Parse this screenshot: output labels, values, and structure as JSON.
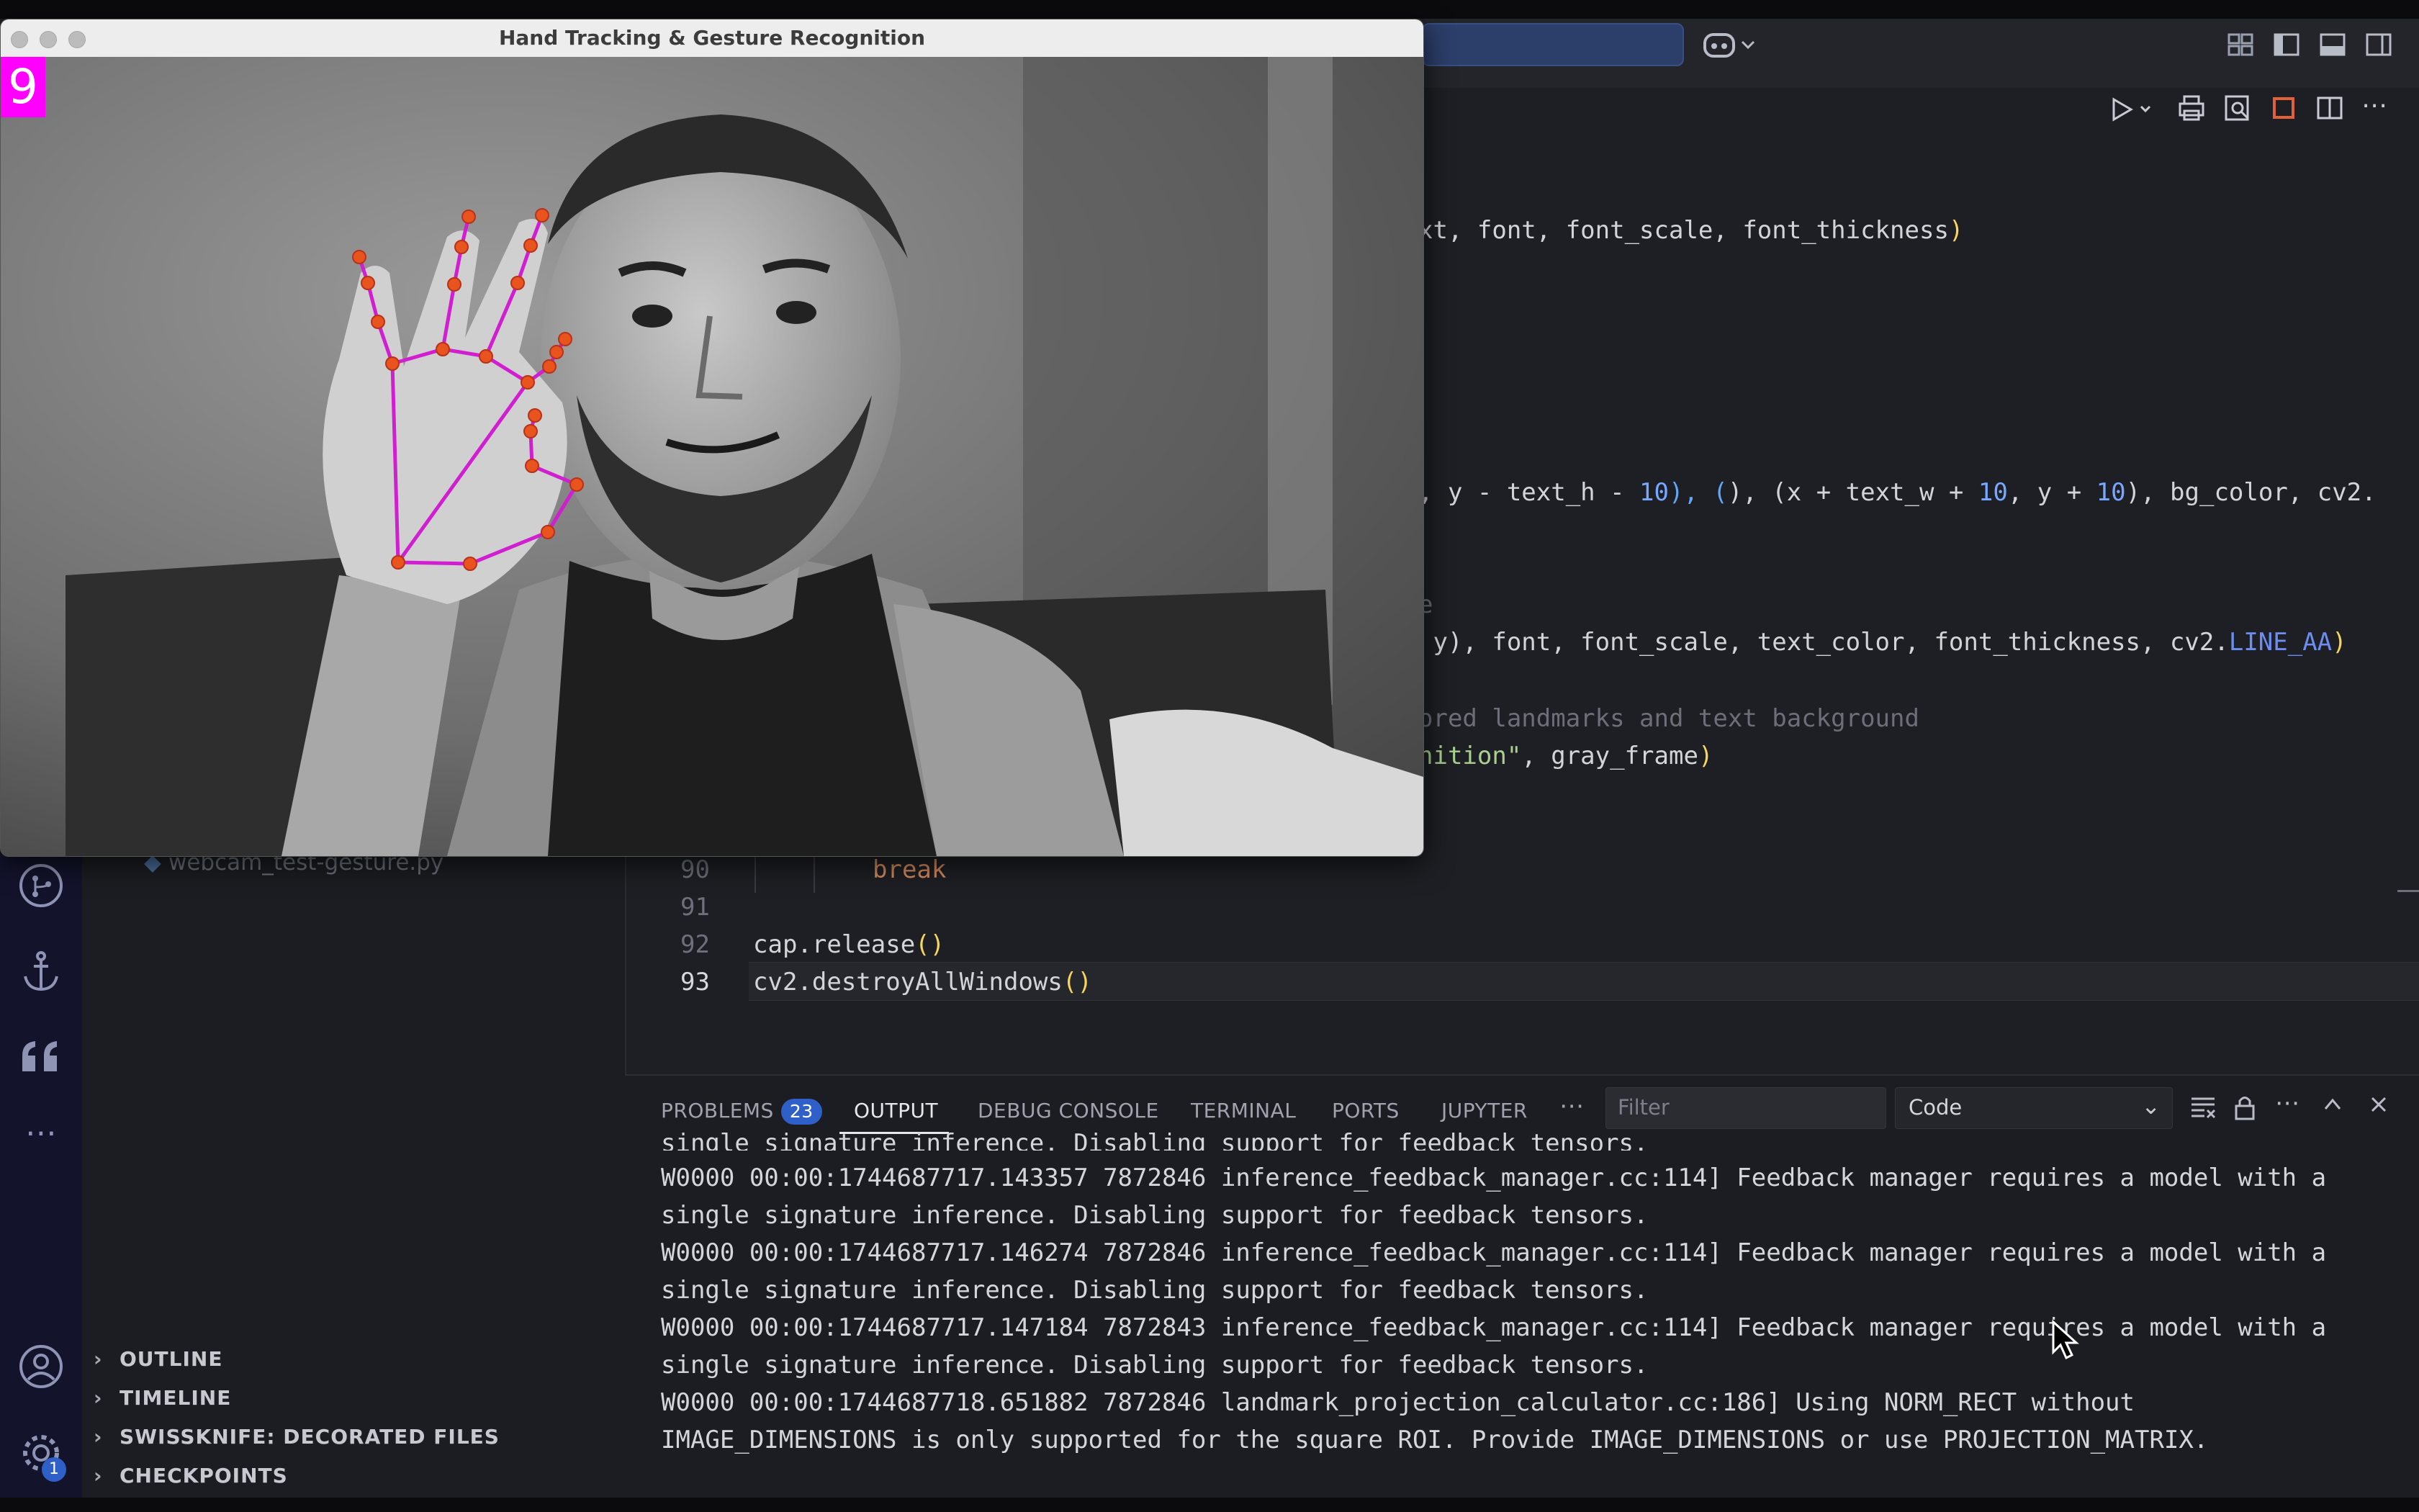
{
  "camera_window": {
    "title": "Hand Tracking & Gesture Recognition",
    "gesture_count": "9"
  },
  "sidebar": {
    "file_name": "webcam_test-gesture.py",
    "sections": [
      "OUTLINE",
      "TIMELINE",
      "SWISSKNIFE: DECORATED FILES",
      "CHECKPOINTS"
    ],
    "settings_badge": "1"
  },
  "editor": {
    "visible_code": {
      "l1": "xt, font, font_scale, font_thickness",
      "l2a": ", y - text_h - ",
      "l2b": "10",
      "l2c": "), (x + text_w + ",
      "l2d": "10",
      "l2e": ", y + ",
      "l2f": "10",
      "l2g": "), bg_color, cv2.",
      "l3": "e",
      "l4a": " y), font, font_scale, text_color, font_thickness, cv2.",
      "l4b": "LINE_AA",
      "l5": "ored landmarks and text background",
      "l6a": "nition\"",
      "l6b": ", gray_frame"
    },
    "lines": [
      {
        "n": "90",
        "code": "break"
      },
      {
        "n": "91",
        "code": ""
      },
      {
        "n": "92",
        "code": "cap.release"
      },
      {
        "n": "93",
        "code": "cv2.destroyAllWindows"
      }
    ]
  },
  "panel": {
    "tabs": [
      "PROBLEMS",
      "OUTPUT",
      "DEBUG CONSOLE",
      "TERMINAL",
      "PORTS",
      "JUPYTER"
    ],
    "problems_count": "23",
    "filter_placeholder": "Filter",
    "channel": "Code",
    "output_lines": [
      "single signature inference. Disabling support for feedback tensors.",
      "W0000 00:00:1744687717.143357 7872846 inference_feedback_manager.cc:114] Feedback manager requires a model with a",
      "single signature inference. Disabling support for feedback tensors.",
      "W0000 00:00:1744687717.146274 7872846 inference_feedback_manager.cc:114] Feedback manager requires a model with a",
      "single signature inference. Disabling support for feedback tensors.",
      "W0000 00:00:1744687717.147184 7872843 inference_feedback_manager.cc:114] Feedback manager requires a model with a",
      "single signature inference. Disabling support for feedback tensors.",
      "W0000 00:00:1744687718.651882 7872846 landmark_projection_calculator.cc:186] Using NORM_RECT without",
      "IMAGE_DIMENSIONS is only supported for the square ROI. Provide IMAGE_DIMENSIONS or use PROJECTION_MATRIX."
    ]
  },
  "colors": {
    "landmark_line": "#d01ed0",
    "landmark_point": "#e8531e",
    "gesture_bg": "#ff00ff",
    "accent": "#2f5fc8"
  }
}
